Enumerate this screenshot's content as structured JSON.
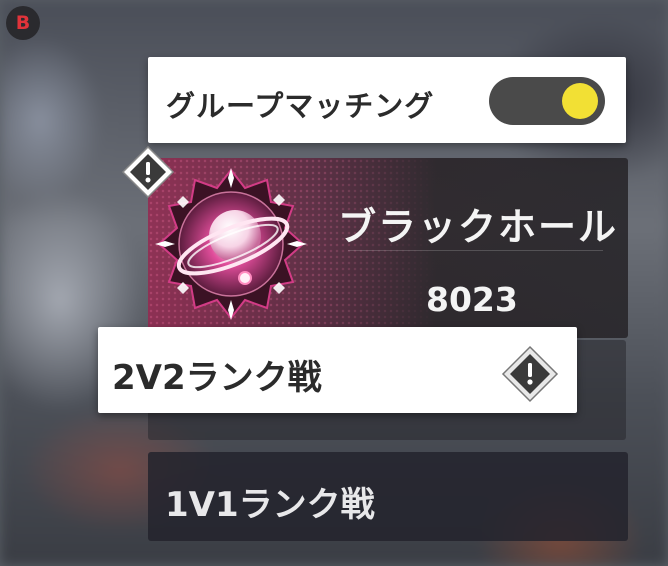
{
  "back_button": {
    "label": "B",
    "color": "#e0333a"
  },
  "group_matching": {
    "label": "グループマッチング",
    "enabled": true,
    "knob_color": "#f2e034"
  },
  "rank_card": {
    "rank_name": "ブラックホール",
    "score": "8023",
    "emblem": "black-hole-rank-emblem"
  },
  "modes": [
    {
      "label": "2V2ランク戦",
      "selected": true,
      "warning": true
    },
    {
      "label": "1V1ランク戦",
      "selected": false,
      "warning": false
    }
  ],
  "icons": {
    "warning": "warning-diamond-icon"
  }
}
